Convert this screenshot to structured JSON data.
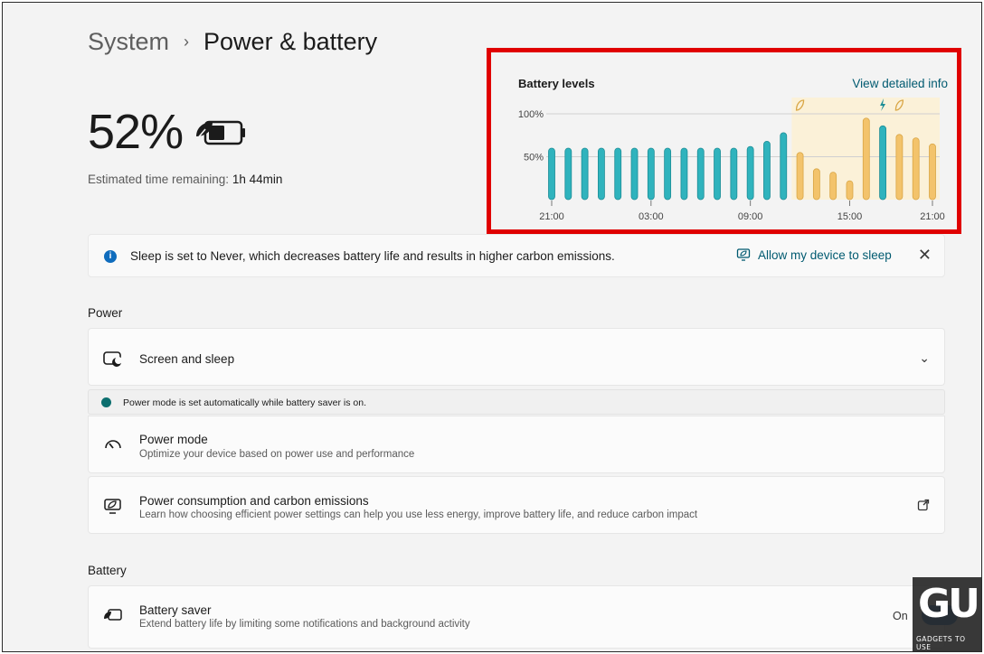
{
  "breadcrumb": {
    "parent": "System",
    "separator": "›",
    "current": "Power & battery"
  },
  "battery": {
    "percent": "52%",
    "est_label": "Estimated time remaining:",
    "est_value": "1h 44min",
    "icon": "battery-leaf-icon"
  },
  "chart_card": {
    "title": "Battery levels",
    "link": "View detailed info"
  },
  "chart_data": {
    "type": "bar",
    "title": "Battery levels",
    "y_ticks": [
      "100%",
      "50%"
    ],
    "x_ticks": [
      "21:00",
      "03:00",
      "09:00",
      "15:00",
      "21:00"
    ],
    "ylim": [
      0,
      100
    ],
    "values": [
      60,
      60,
      60,
      60,
      60,
      60,
      60,
      60,
      60,
      60,
      60,
      60,
      62,
      68,
      78,
      55,
      36,
      32,
      22,
      95,
      86,
      76,
      72,
      65
    ],
    "states": [
      "plugged",
      "plugged",
      "plugged",
      "plugged",
      "plugged",
      "plugged",
      "plugged",
      "plugged",
      "plugged",
      "plugged",
      "plugged",
      "plugged",
      "plugged",
      "plugged",
      "plugged",
      "battery",
      "battery",
      "battery",
      "battery",
      "battery",
      "plugged",
      "battery",
      "battery",
      "battery"
    ],
    "colors": {
      "plugged": "#2fb3bd",
      "battery": "#f3c36b",
      "saver_band": "#fbf1d8",
      "grid": "#d0d0d0"
    },
    "markers": [
      {
        "index": 15,
        "icon": "leaf-icon"
      },
      {
        "index": 20,
        "icon": "lightning-icon"
      },
      {
        "index": 21,
        "icon": "leaf-icon"
      }
    ]
  },
  "info_bar": {
    "text": "Sleep is set to Never, which decreases battery life and results in higher carbon emissions.",
    "action": "Allow my device to sleep",
    "close": "✕"
  },
  "power": {
    "heading": "Power",
    "screen_sleep": {
      "title": "Screen and sleep"
    },
    "notice": "Power mode is set automatically while battery saver is on.",
    "power_mode": {
      "title": "Power mode",
      "subtitle": "Optimize your device based on power use and performance"
    },
    "consumption": {
      "title": "Power consumption and carbon emissions",
      "subtitle": "Learn how choosing efficient power settings can help you use less energy, improve battery life, and reduce carbon impact"
    }
  },
  "battery_section": {
    "heading": "Battery",
    "saver": {
      "title": "Battery saver",
      "subtitle": "Extend battery life by limiting some notifications and background activity",
      "state": "On"
    }
  },
  "watermark": {
    "mark": "GU",
    "text": "GADGETS TO USE"
  }
}
